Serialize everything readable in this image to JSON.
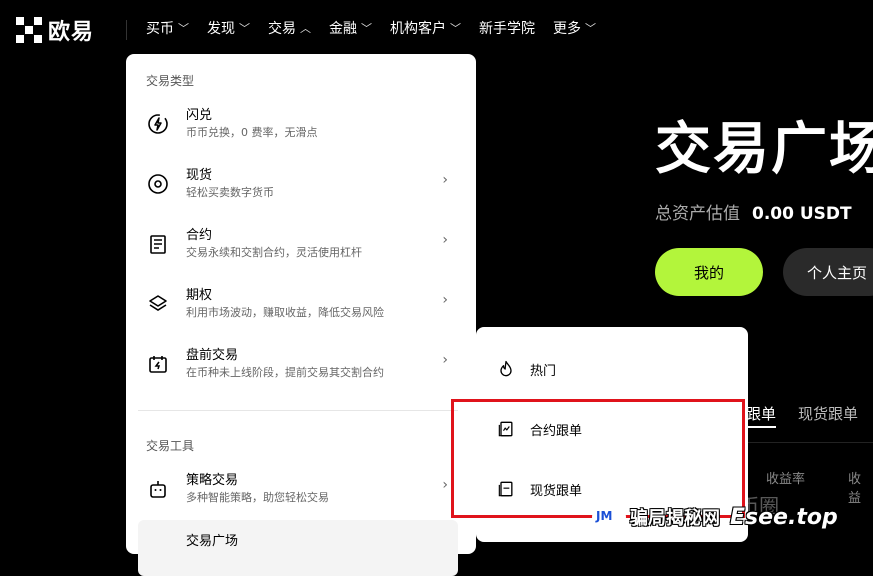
{
  "logo": {
    "text": "欧易"
  },
  "nav": [
    {
      "label": "买币",
      "chevron": "down"
    },
    {
      "label": "发现",
      "chevron": "down"
    },
    {
      "label": "交易",
      "chevron": "up"
    },
    {
      "label": "金融",
      "chevron": "down"
    },
    {
      "label": "机构客户",
      "chevron": "down"
    },
    {
      "label": "新手学院",
      "chevron": ""
    },
    {
      "label": "更多",
      "chevron": "down"
    }
  ],
  "hero": {
    "title": "交易广场",
    "assets_label": "总资产估值",
    "assets_value": "0.00 USDT",
    "mine_button": "我的",
    "profile_button": "个人主页"
  },
  "background_tabs": {
    "tab1": "跟单",
    "tab2": "现货跟单",
    "col1": "收益率",
    "col2": "收益"
  },
  "dropdown": {
    "section1": "交易类型",
    "items": [
      {
        "title": "闪兑",
        "subtitle": "币币兑换，0 费率，无滑点",
        "icon": "lightning-icon"
      },
      {
        "title": "现货",
        "subtitle": "轻松买卖数字货币",
        "icon": "coin-icon"
      },
      {
        "title": "合约",
        "subtitle": "交易永续和交割合约，灵活使用杠杆",
        "icon": "contract-icon"
      },
      {
        "title": "期权",
        "subtitle": "利用市场波动，赚取收益，降低交易风险",
        "icon": "layers-icon"
      },
      {
        "title": "盘前交易",
        "subtitle": "在币种未上线阶段，提前交易其交割合约",
        "icon": "calendar-icon"
      }
    ],
    "section2": "交易工具",
    "tool_items": [
      {
        "title": "策略交易",
        "subtitle": "多种智能策略，助您轻松交易",
        "icon": "robot-icon"
      },
      {
        "title": "交易广场",
        "subtitle": "",
        "icon": ""
      }
    ]
  },
  "submenu": {
    "items": [
      {
        "label": "热门",
        "icon": "fire-icon"
      },
      {
        "label": "合约跟单",
        "icon": "contract-copy-icon"
      },
      {
        "label": "现货跟单",
        "icon": "spot-copy-icon"
      }
    ]
  },
  "watermark": {
    "faded": "公众号 · 爱币圈",
    "logo": "JM",
    "cn": "骗局揭秘网",
    "en": "Esee.top"
  },
  "colors": {
    "accent": "#b3f53b",
    "highlight": "#e0131b"
  }
}
